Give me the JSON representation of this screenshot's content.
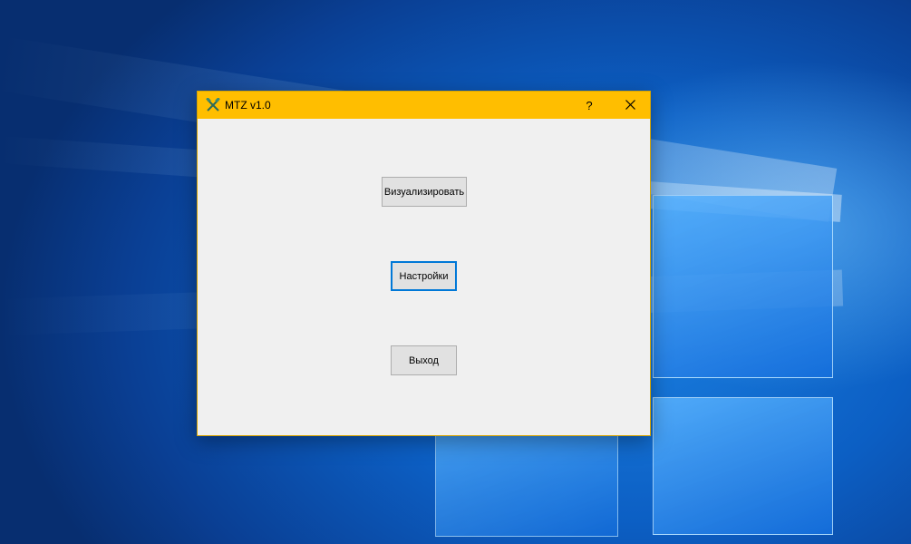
{
  "window": {
    "title": "MTZ v1.0",
    "icon": "crossed-hammers-icon",
    "title_bar_color": "#ffbe00",
    "help_label": "?",
    "close_label": "✕"
  },
  "buttons": {
    "visualize_label": "Визуализировать",
    "settings_label": "Настройки",
    "exit_label": "Выход"
  },
  "colors": {
    "focus_accent": "#0078d7",
    "desktop_blue": "#0c5fc4"
  }
}
